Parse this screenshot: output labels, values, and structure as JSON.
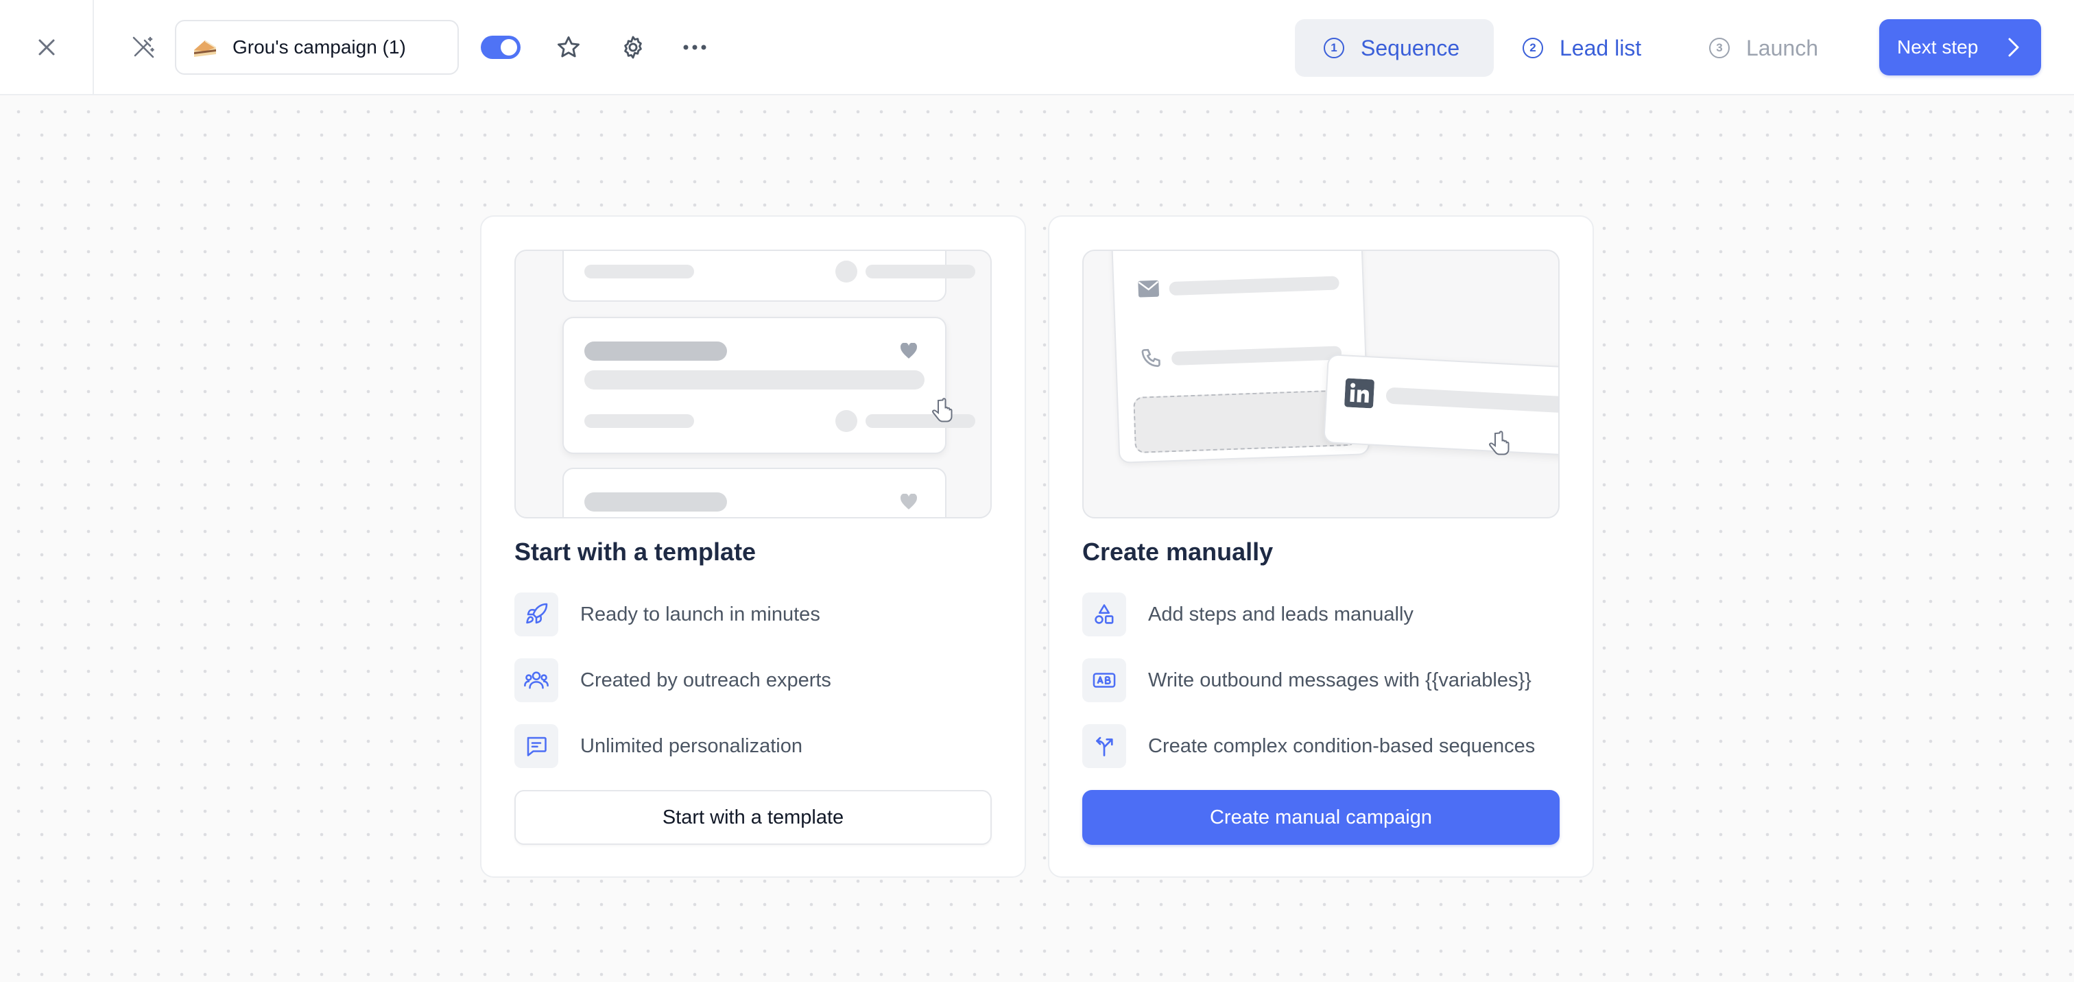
{
  "header": {
    "campaign_name": "Grou's campaign (1)",
    "toggle_on": true,
    "steps": [
      {
        "num": "1",
        "label": "Sequence",
        "state": "active"
      },
      {
        "num": "2",
        "label": "Lead list",
        "state": "available"
      },
      {
        "num": "3",
        "label": "Launch",
        "state": "disabled"
      }
    ],
    "next_label": "Next step",
    "accent_color": "#4c6ef5"
  },
  "template_card": {
    "title": "Start with a template",
    "features": [
      {
        "icon": "rocket-icon",
        "text": "Ready to launch in minutes"
      },
      {
        "icon": "users-icon",
        "text": "Created by outreach experts"
      },
      {
        "icon": "message-icon",
        "text": "Unlimited personalization"
      }
    ],
    "button_label": "Start with a template"
  },
  "manual_card": {
    "title": "Create manually",
    "features": [
      {
        "icon": "shapes-icon",
        "text": "Add steps and leads manually"
      },
      {
        "icon": "variable-ab-icon",
        "text": "Write outbound messages with {{variables}}"
      },
      {
        "icon": "split-arrow-icon",
        "text": "Create complex condition-based sequences"
      }
    ],
    "button_label": "Create manual campaign"
  }
}
